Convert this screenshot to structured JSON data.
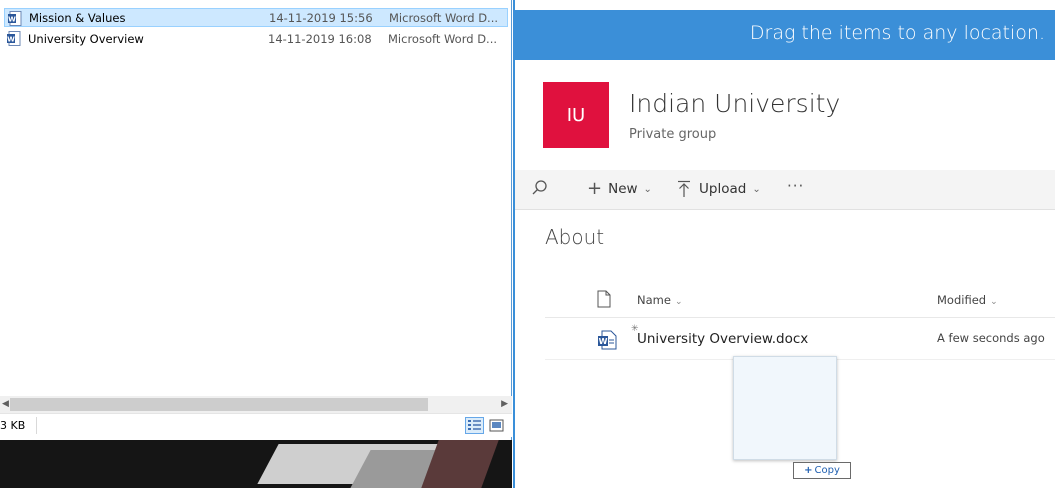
{
  "explorer": {
    "files": [
      {
        "name": "Mission & Values",
        "date": "14-11-2019 15:56",
        "type": "Microsoft Word D...",
        "selected": true,
        "icon": "word-doc-icon"
      },
      {
        "name": "University Overview",
        "date": "14-11-2019 16:08",
        "type": "Microsoft Word D...",
        "selected": false,
        "icon": "word-doc-icon"
      }
    ],
    "status_size": "3 KB",
    "views": [
      "details-view-icon",
      "large-icons-view-icon"
    ]
  },
  "sharepoint": {
    "drag_banner": "Drag the items to any location.",
    "group_initials": "IU",
    "group_name": "Indian University",
    "group_type": "Private group",
    "commands": {
      "new_label": "New",
      "upload_label": "Upload",
      "more_label": "···"
    },
    "section_title": "About",
    "columns": {
      "name": "Name",
      "modified": "Modified"
    },
    "rows": [
      {
        "name": "University Overview.docx",
        "modified": "A few seconds ago",
        "icon": "word-doc-icon"
      }
    ],
    "drag_tooltip": "Copy",
    "colors": {
      "accent": "#3b8fd8",
      "group_tile": "#e0113e",
      "selection": "#cde8ff"
    }
  }
}
